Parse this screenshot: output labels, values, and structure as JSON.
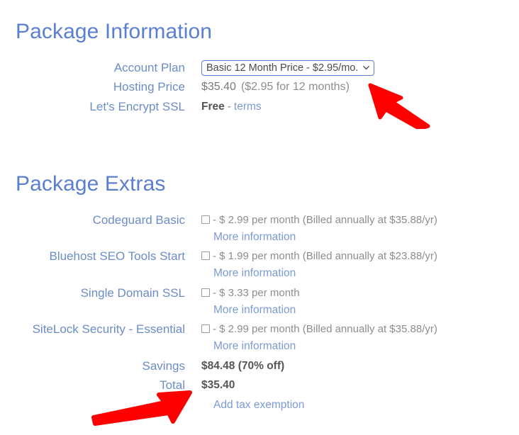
{
  "colors": {
    "heading_blue": "#5a7fd0",
    "label_blue": "#6c8cc7",
    "link_blue": "#7b9ad6",
    "value_gray": "#7a7a7a",
    "bold_gray": "#555555",
    "annotation_red": "#ff0000",
    "background": "#ffffff"
  },
  "package_information": {
    "heading": "Package Information",
    "rows": {
      "account_plan": {
        "label": "Account Plan",
        "selected_option": "Basic 12 Month Price - $2.95/mo.",
        "chevron_icon": "chevron-down-icon"
      },
      "hosting_price": {
        "label": "Hosting Price",
        "amount": "$35.40",
        "term": "($2.95 for 12 months)"
      },
      "lets_encrypt_ssl": {
        "label": "Let's Encrypt SSL",
        "value": "Free",
        "separator": "-",
        "link": "terms"
      }
    }
  },
  "package_extras": {
    "heading": "Package Extras",
    "items": [
      {
        "label": "Codeguard Basic",
        "checkbox_icon": "checkbox-unchecked-icon",
        "price_text": "- $ 2.99 per month (Billed annually at $35.88/yr)",
        "more_info": "More information",
        "checked": false
      },
      {
        "label": "Bluehost SEO Tools Start",
        "checkbox_icon": "checkbox-unchecked-icon",
        "price_text": "- $ 1.99 per month (Billed annually at $23.88/yr)",
        "more_info": "More information",
        "checked": false
      },
      {
        "label": "Single Domain SSL",
        "checkbox_icon": "checkbox-unchecked-icon",
        "price_text": "- $ 3.33 per month",
        "more_info": "More information",
        "checked": false
      },
      {
        "label": "SiteLock Security - Essential",
        "checkbox_icon": "checkbox-unchecked-icon",
        "price_text": "- $ 2.99 per month (Billed annually at $35.88/yr)",
        "more_info": "More information",
        "checked": false
      }
    ],
    "savings": {
      "label": "Savings",
      "value": "$84.48 (70% off)"
    },
    "total": {
      "label": "Total",
      "value": "$35.40"
    },
    "tax_exemption": {
      "link": "Add tax exemption"
    }
  },
  "annotations": [
    {
      "name": "arrow-hosting-price",
      "icon": "arrow-up-left-icon",
      "color": "#ff0000",
      "points_at": "hosting-price-value"
    },
    {
      "name": "arrow-total",
      "icon": "arrow-up-right-icon",
      "color": "#ff0000",
      "points_at": "total-label"
    }
  ]
}
